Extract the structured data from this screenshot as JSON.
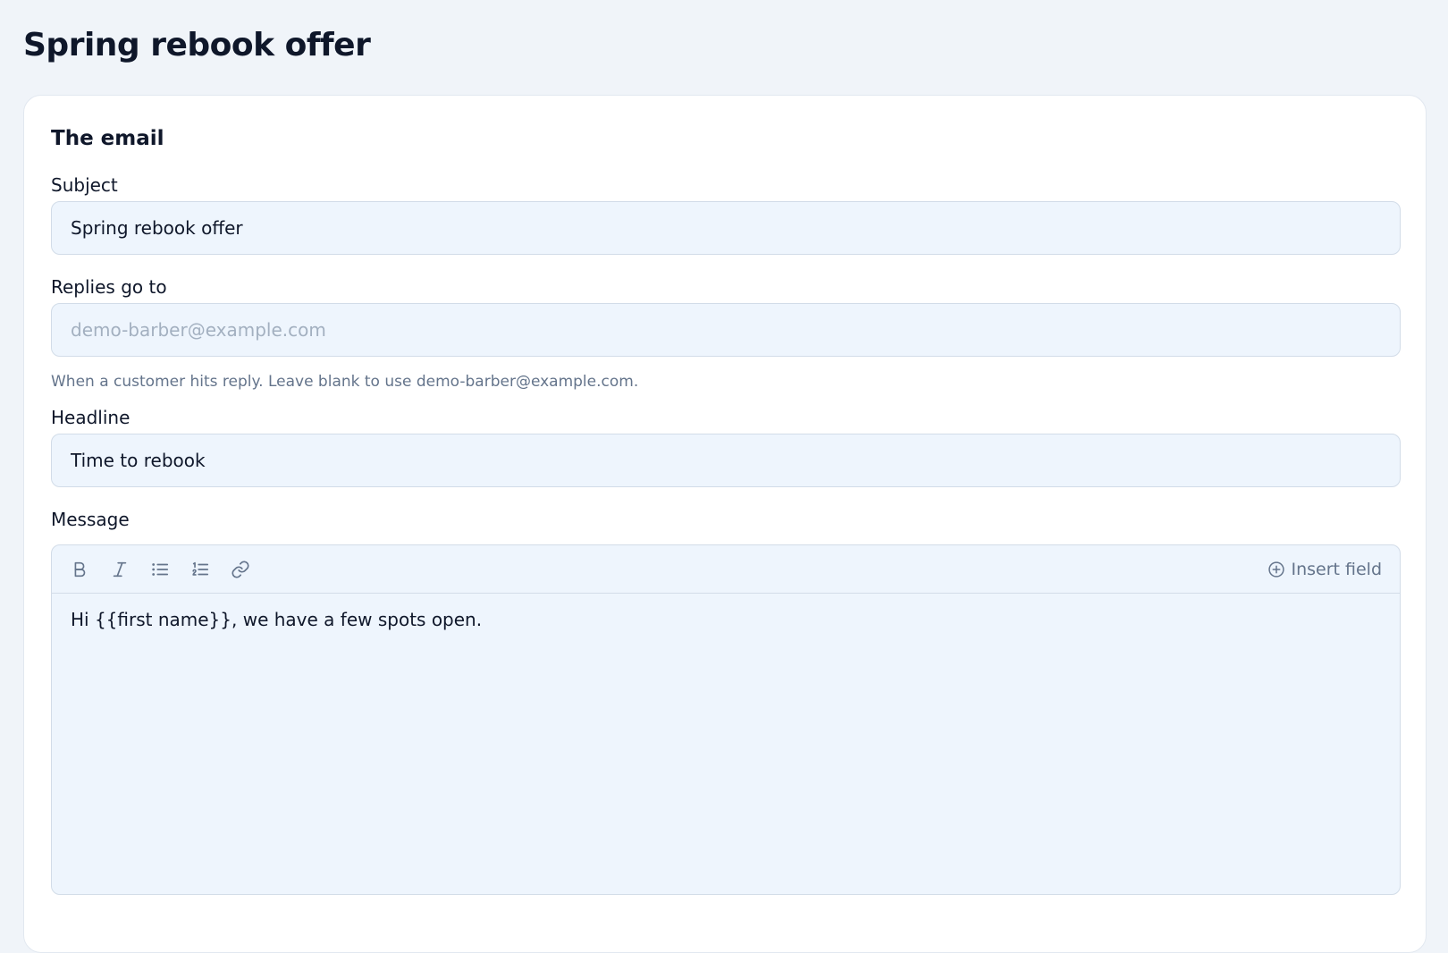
{
  "page": {
    "title": "Spring rebook offer"
  },
  "email_section": {
    "title": "The email",
    "subject": {
      "label": "Subject",
      "value": "Spring rebook offer"
    },
    "reply_to": {
      "label": "Replies go to",
      "value": "",
      "placeholder": "demo-barber@example.com",
      "help": "When a customer hits reply. Leave blank to use demo-barber@example.com."
    },
    "headline": {
      "label": "Headline",
      "value": "Time to rebook"
    },
    "message": {
      "label": "Message",
      "body": "Hi {{first name}}, we have a few spots open.",
      "toolbar": {
        "bold_icon": "bold-icon",
        "italic_icon": "italic-icon",
        "bullet_list_icon": "bullet-list-icon",
        "numbered_list_icon": "numbered-list-icon",
        "link_icon": "link-icon",
        "insert_field_label": "Insert field"
      }
    }
  },
  "colors": {
    "background": "#f0f4f9",
    "card": "#ffffff",
    "input_background": "#eef5fd",
    "input_border": "#d2dce8",
    "text": "#0f172a",
    "muted_text": "#64748b",
    "placeholder": "#a3b0c0"
  }
}
